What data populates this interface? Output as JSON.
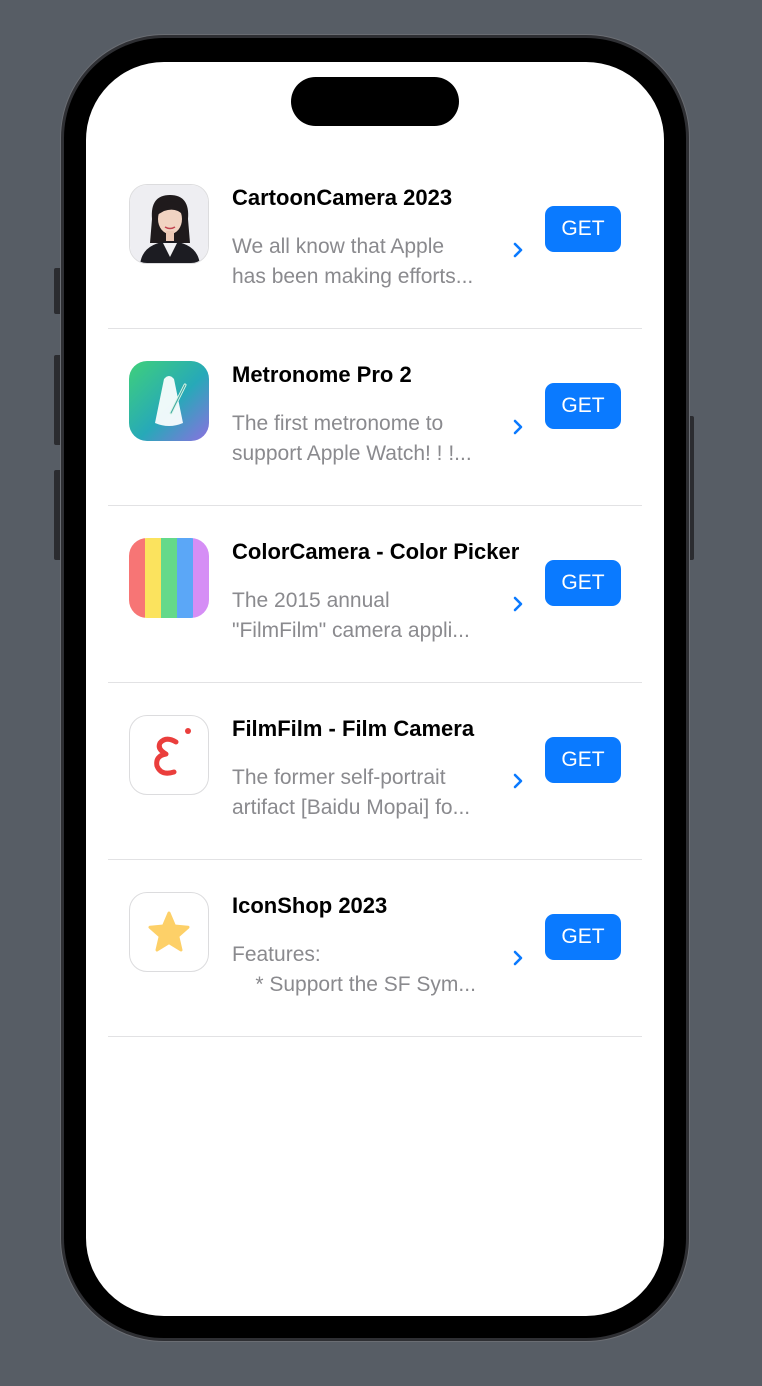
{
  "apps": [
    {
      "name": "CartoonCamera 2023",
      "desc_line1": "We all know that Apple",
      "desc_line2": "has been making efforts...",
      "button": "GET",
      "icon": "portrait-photo-icon"
    },
    {
      "name": "Metronome Pro 2",
      "desc_line1": "The first metronome to",
      "desc_line2": "support Apple Watch! ! !...",
      "button": "GET",
      "icon": "metronome-icon"
    },
    {
      "name": "ColorCamera - Color Picker",
      "desc_line1": "The 2015 annual",
      "desc_line2": "\"FilmFilm\" camera appli...",
      "button": "GET",
      "icon": "color-stripes-icon"
    },
    {
      "name": "FilmFilm - Film Camera",
      "desc_line1": "The former self-portrait",
      "desc_line2": "artifact [Baidu Mopai] fo...",
      "button": "GET",
      "icon": "filmfilm-logo-icon"
    },
    {
      "name": "IconShop 2023",
      "desc_line1": "Features:",
      "desc_line2": "    * Support the SF Sym...",
      "button": "GET",
      "icon": "star-icon"
    }
  ],
  "colors": {
    "accent": "#0a7aff",
    "secondary_text": "#8a8a8e",
    "separator": "#e2e2e4",
    "background": "#575d65"
  }
}
